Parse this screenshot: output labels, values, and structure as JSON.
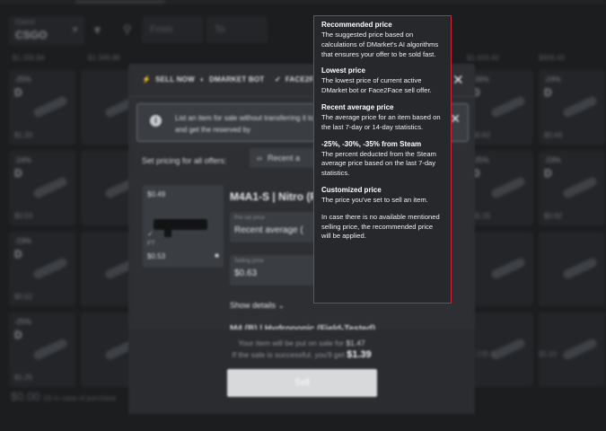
{
  "background": {
    "game_select": {
      "label": "Game",
      "value": "CSGO"
    },
    "price_from_placeholder": "From",
    "price_to_placeholder": "To",
    "cards": [
      {
        "disc": "-25%",
        "d": "D",
        "price": "$1.33"
      },
      {
        "disc": "-24%",
        "d": "D",
        "price": "$0.53"
      },
      {
        "disc": "-23%",
        "d": "D",
        "price": "$0.52"
      },
      {
        "disc": "-25%",
        "d": "D",
        "price": "$1.25"
      },
      {
        "disc": "-26%",
        "d": "D",
        "price": "$0.62"
      },
      {
        "disc": "-25%",
        "d": "D",
        "price": "$1.15"
      },
      {
        "disc": "-24%",
        "d": "D",
        "price": "$0.44"
      },
      {
        "disc": "-23%",
        "d": "D",
        "price": "$0.92"
      }
    ],
    "row_prices": [
      "$1.335.84",
      "$1.349.88",
      "$1.423.40",
      "$906.43",
      "$1,235.8",
      "$5.93"
    ],
    "total": "$0.00",
    "total_sub": "(0) in case of purchase"
  },
  "modal": {
    "tabs": [
      {
        "icon": "⚡",
        "label": "SELL NOW"
      },
      {
        "icon": "◐",
        "label": "DMARKET BOT"
      },
      {
        "icon": "✓",
        "label": "FACE2FACE"
      }
    ],
    "notice": "List an item for sale without transferring it to DMarket. Users can accept buy offers and get the reserved by",
    "set_pricing_label": "Set pricing for all offers:",
    "set_pricing_value": "Recent a",
    "item": {
      "top_price": "$0.49",
      "float": "FT",
      "bottom_price": "$0.53",
      "name": "M4A1-S | Nitro (F",
      "field1_label": "Pre-set price",
      "field1_value": "Recent average (",
      "field2_label": "Selling price",
      "field2_value": "$0.63"
    },
    "show_details": "Show details",
    "next_item": "M4 (B) | Hydroponic (Field-Tested)",
    "put_line_text": "Your item will be put on sale for",
    "put_line_value": "$1.47",
    "get_line_text": "If the sale is successful, you'll get",
    "get_line_value": "$1.39",
    "sell_label": "Sell"
  },
  "tooltip": {
    "sections": [
      {
        "heading": "Recommended price",
        "text": "The suggested price based on calculations of DMarket's AI algorithms that ensures your offer to be sold fast."
      },
      {
        "heading": "Lowest price",
        "text": "The lowest price of current active DMarket bot or Face2Face sell offer."
      },
      {
        "heading": "Recent average price",
        "text": "The average price for an item based on the last 7-day or 14-day statistics."
      },
      {
        "heading": "-25%, -30%, -35% from Steam",
        "text": "The percent deducted from the Steam average price based on the last 7-day statistics."
      },
      {
        "heading": "Customized price",
        "text": "The price you've set to sell an item."
      }
    ],
    "footnote": "In case there is no available mentioned selling price, the recommended price will be applied."
  }
}
